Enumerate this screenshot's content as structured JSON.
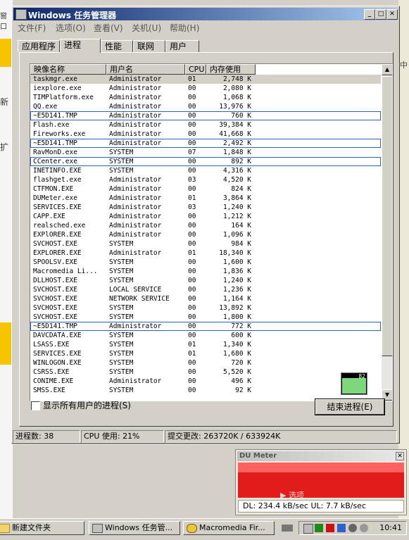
{
  "background": {
    "left_tabs": [
      "窗口",
      "新",
      "扩"
    ],
    "right_fragment": "中"
  },
  "window": {
    "title": "Windows 任务管理器",
    "menu": [
      "文件(F)",
      "选项(O)",
      "查看(V)",
      "关机(U)",
      "帮助(H)"
    ],
    "tabs": [
      "应用程序",
      "进程",
      "性能",
      "联网",
      "用户"
    ],
    "active_tab": "进程",
    "columns": [
      "映像名称",
      "用户名",
      "CPU",
      "内存使用"
    ],
    "processes": [
      {
        "name": "taskmgr.exe",
        "user": "Administrator",
        "cpu": "01",
        "mem": "2,748 K"
      },
      {
        "name": "iexplore.exe",
        "user": "Administrator",
        "cpu": "00",
        "mem": "2,080 K"
      },
      {
        "name": "TIMPlatform.exe",
        "user": "Administrator",
        "cpu": "00",
        "mem": "1,068 K"
      },
      {
        "name": "QQ.exe",
        "user": "Administrator",
        "cpu": "00",
        "mem": "13,976 K"
      },
      {
        "name": "~E5D141.TMP",
        "user": "Administrator",
        "cpu": "00",
        "mem": "760 K"
      },
      {
        "name": "Flash.exe",
        "user": "Administrator",
        "cpu": "00",
        "mem": "39,384 K"
      },
      {
        "name": "Fireworks.exe",
        "user": "Administrator",
        "cpu": "00",
        "mem": "41,668 K"
      },
      {
        "name": "~E5D141.TMP",
        "user": "Administrator",
        "cpu": "00",
        "mem": "2,492 K"
      },
      {
        "name": "RavMonD.exe",
        "user": "SYSTEM",
        "cpu": "07",
        "mem": "1,848 K"
      },
      {
        "name": "CCenter.exe",
        "user": "SYSTEM",
        "cpu": "00",
        "mem": "892 K"
      },
      {
        "name": "INETINFO.EXE",
        "user": "SYSTEM",
        "cpu": "00",
        "mem": "4,316 K"
      },
      {
        "name": "flashget.exe",
        "user": "Administrator",
        "cpu": "03",
        "mem": "4,520 K"
      },
      {
        "name": "CTFMON.EXE",
        "user": "Administrator",
        "cpu": "00",
        "mem": "824 K"
      },
      {
        "name": "DUMeter.exe",
        "user": "Administrator",
        "cpu": "01",
        "mem": "3,864 K"
      },
      {
        "name": "SERVICES.EXE",
        "user": "Administrator",
        "cpu": "03",
        "mem": "1,240 K"
      },
      {
        "name": "CAPP.EXE",
        "user": "Administrator",
        "cpu": "00",
        "mem": "1,212 K"
      },
      {
        "name": "realsched.exe",
        "user": "Administrator",
        "cpu": "00",
        "mem": "164 K"
      },
      {
        "name": "EXPlORER.EXE",
        "user": "Administrator",
        "cpu": "00",
        "mem": "1,096 K"
      },
      {
        "name": "SVCHOST.EXE",
        "user": "SYSTEM",
        "cpu": "00",
        "mem": "984 K"
      },
      {
        "name": "EXPLORER.EXE",
        "user": "Administrator",
        "cpu": "01",
        "mem": "18,340 K"
      },
      {
        "name": "SPOOLSV.EXE",
        "user": "SYSTEM",
        "cpu": "00",
        "mem": "1,600 K"
      },
      {
        "name": "Macromedia Li...",
        "user": "SYSTEM",
        "cpu": "00",
        "mem": "1,836 K"
      },
      {
        "name": "DLLHOST.EXE",
        "user": "SYSTEM",
        "cpu": "00",
        "mem": "1,240 K"
      },
      {
        "name": "SVCHOST.EXE",
        "user": "LOCAL SERVICE",
        "cpu": "00",
        "mem": "1,236 K"
      },
      {
        "name": "SVCHOST.EXE",
        "user": "NETWORK SERVICE",
        "cpu": "00",
        "mem": "1,164 K"
      },
      {
        "name": "SVCHOST.EXE",
        "user": "SYSTEM",
        "cpu": "00",
        "mem": "13,892 K"
      },
      {
        "name": "SVCHOST.EXE",
        "user": "SYSTEM",
        "cpu": "00",
        "mem": "1,800 K"
      },
      {
        "name": "~E5D141.TMP",
        "user": "Administrator",
        "cpu": "00",
        "mem": "772 K"
      },
      {
        "name": "DAVCDATA.EXE",
        "user": "SYSTEM",
        "cpu": "00",
        "mem": "600 K"
      },
      {
        "name": "LSASS.EXE",
        "user": "SYSTEM",
        "cpu": "01",
        "mem": "1,340 K"
      },
      {
        "name": "SERVICES.EXE",
        "user": "SYSTEM",
        "cpu": "01",
        "mem": "1,680 K"
      },
      {
        "name": "WINLOGON.EXE",
        "user": "SYSTEM",
        "cpu": "00",
        "mem": "720 K"
      },
      {
        "name": "CSRSS.EXE",
        "user": "SYSTEM",
        "cpu": "00",
        "mem": "5,520 K"
      },
      {
        "name": "CONIME.EXE",
        "user": "Administrator",
        "cpu": "00",
        "mem": "496 K"
      },
      {
        "name": "SMSS.EXE",
        "user": "SYSTEM",
        "cpu": "00",
        "mem": "92 K"
      }
    ],
    "cpu_mini_label": "82",
    "show_all_label": "显示所有用户的进程(S)",
    "end_process_label": "结束进程(E)",
    "status": {
      "processes": "进程数: 38",
      "cpu": "CPU 使用: 21%",
      "commit": "提交更改: 263720K / 633924K"
    }
  },
  "dumeter": {
    "title": "DU Meter",
    "graph_label": "▶ 选项",
    "readout": "DL: 234.4 kB/sec  UL: 7.7 kB/sec"
  },
  "taskbar": {
    "buttons": [
      "新建文件夹",
      "Windows 任务管...",
      "Macromedia Fir..."
    ],
    "clock": "10:41"
  },
  "colors": {
    "title_start": "#0a246a",
    "title_end": "#a6caf0",
    "du_graph": "#e21b1b",
    "select_box": "#3060c0"
  }
}
